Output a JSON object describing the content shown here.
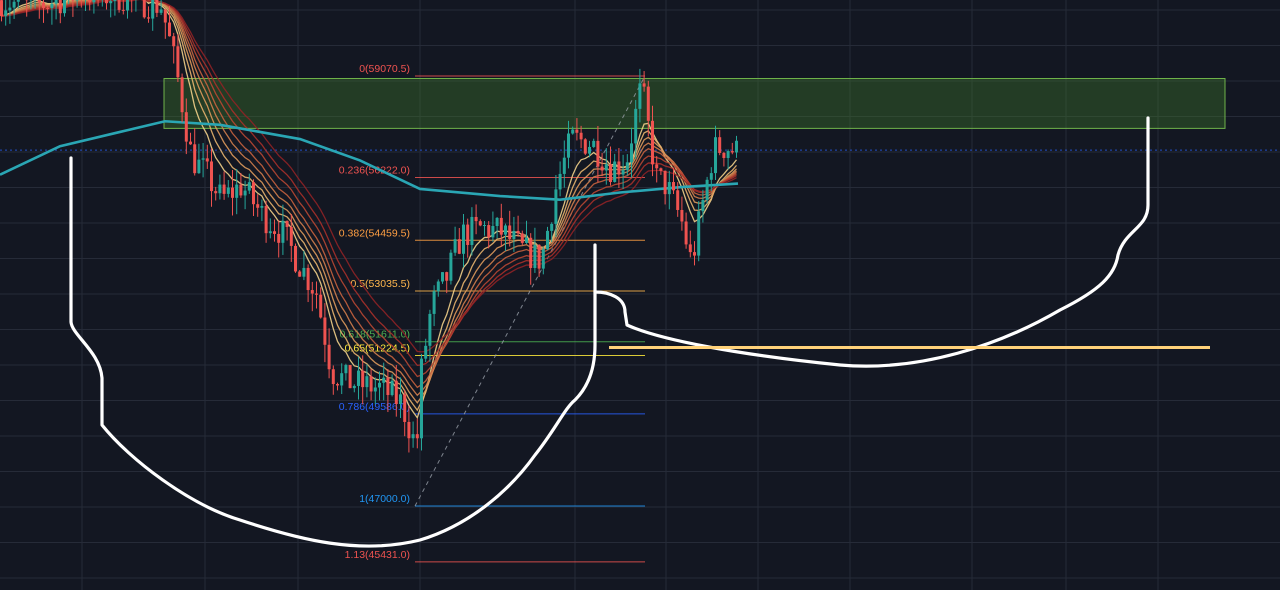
{
  "chart_data": {
    "type": "candlestick",
    "title": "",
    "xlabel": "",
    "ylabel": "",
    "ylim": [
      44000,
      61500
    ],
    "grid": true,
    "colors": {
      "background": "#131722",
      "grid": "#262b38",
      "up": "#26a69a",
      "down": "#ef5350",
      "ema_200": "#2aa6b4",
      "ribbon_fast": "#f0c070",
      "ribbon_slow": "#b01f2a",
      "resistance_zone": "#3f7a2a",
      "target_line": "#ffd27a",
      "pattern_drawing": "#ffffff",
      "trend_line": "#9aa0aa",
      "price_line": "#2962ff"
    },
    "fibonacci": [
      {
        "level": "0",
        "price": 59070.5,
        "text": "0(59070.5)",
        "color": "#ef5350"
      },
      {
        "level": "0.236",
        "price": 56222.0,
        "text": "0.236(56222.0)",
        "color": "#ef5350"
      },
      {
        "level": "0.382",
        "price": 54459.5,
        "text": "0.382(54459.5)",
        "color": "#ff9f43"
      },
      {
        "level": "0.5",
        "price": 53035.5,
        "text": "0.5(53035.5)",
        "color": "#ffb74d"
      },
      {
        "level": "0.618",
        "price": 51611.0,
        "text": "0.618(51611.0)",
        "color": "#4caf50"
      },
      {
        "level": "0.65",
        "price": 51224.5,
        "text": "0.65(51224.5)",
        "color": "#ffeb3b"
      },
      {
        "level": "0.786",
        "price": 49586.0,
        "text": "0.786(49586.0)",
        "color": "#2962ff"
      },
      {
        "level": "1",
        "price": 47000.0,
        "text": "1(47000.0)",
        "color": "#2196f3"
      },
      {
        "level": "1.13",
        "price": 45431.0,
        "text": "1.13(45431.0)",
        "color": "#ef5350"
      }
    ],
    "resistance_zone": {
      "low": 57600,
      "high": 59000
    },
    "target_level": 51450,
    "current_price": 56990
  }
}
